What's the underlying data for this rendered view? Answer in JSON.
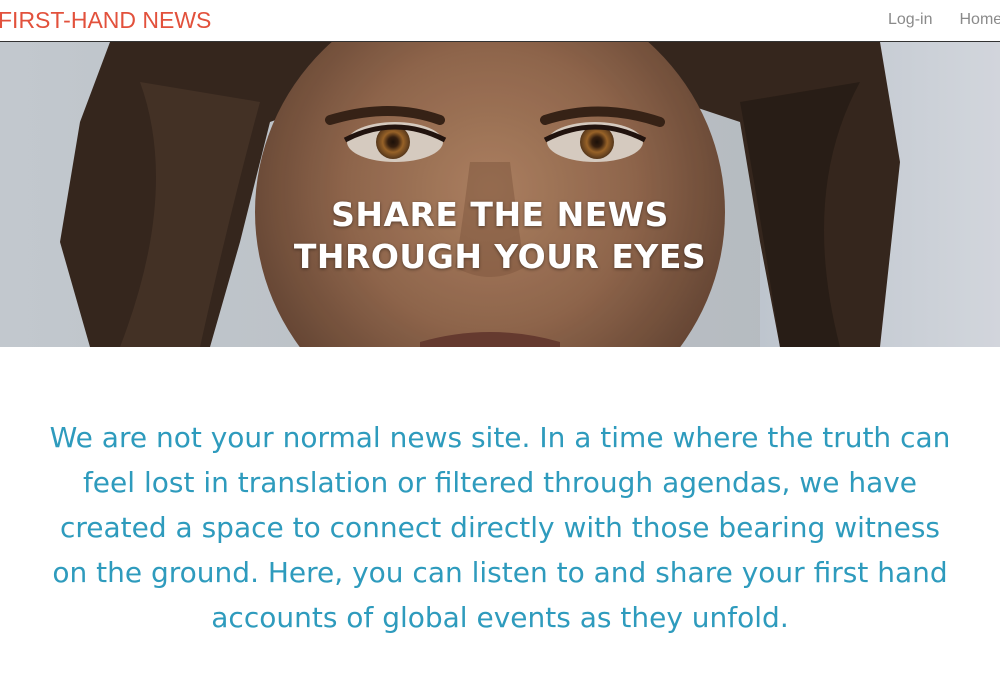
{
  "header": {
    "brand": "FIRST-HAND NEWS",
    "nav": [
      {
        "label": "Log-in"
      },
      {
        "label": "Home"
      }
    ]
  },
  "hero": {
    "title_line1": "SHARE THE NEWS",
    "title_line2": "THROUGH YOUR EYES"
  },
  "intro": {
    "text": "We are not your normal news site. In a time where the truth can feel lost in translation or filtered through agendas, we have created a space to connect directly with those bearing witness on the ground. Here, you can listen to and share your first hand accounts of global events as they unfold."
  },
  "colors": {
    "brand": "#e2513c",
    "nav_text": "#8a8a8a",
    "intro_text": "#2e9bbd",
    "hero_title": "#ffffff"
  }
}
